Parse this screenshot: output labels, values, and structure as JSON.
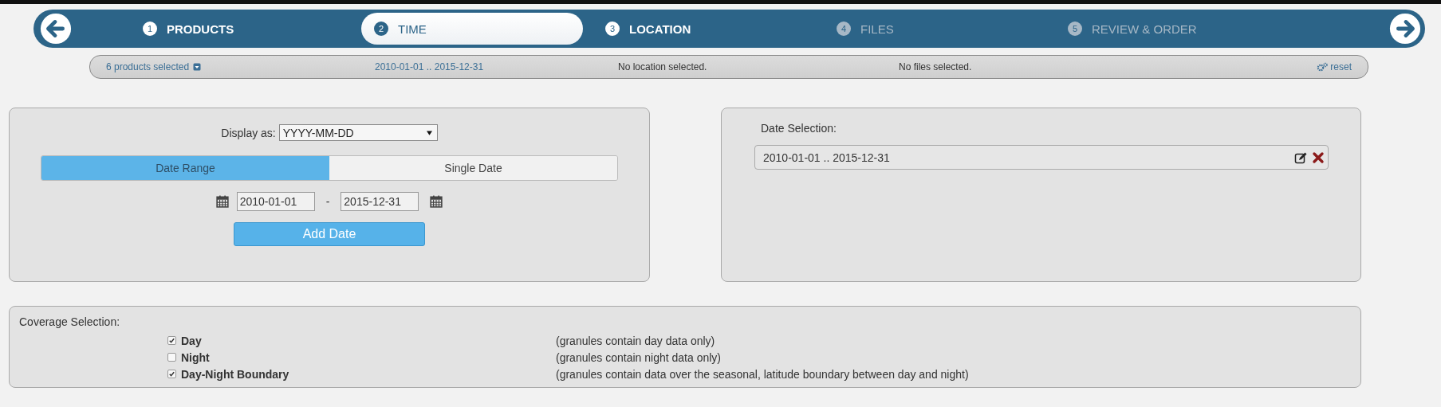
{
  "wizard": {
    "steps": [
      {
        "number": "1",
        "label": "PRODUCTS",
        "selected": false,
        "disabled": false
      },
      {
        "number": "2",
        "label": "TIME",
        "selected": true,
        "disabled": false
      },
      {
        "number": "3",
        "label": "LOCATION",
        "selected": false,
        "disabled": false
      },
      {
        "number": "4",
        "label": "FILES",
        "selected": false,
        "disabled": true
      },
      {
        "number": "5",
        "label": "REVIEW & ORDER",
        "selected": false,
        "disabled": true
      }
    ]
  },
  "summary": {
    "products": "6 products selected",
    "time": "2010-01-01 .. 2015-12-31",
    "location": "No location selected.",
    "files": "No files selected.",
    "reset": "reset"
  },
  "time_panel": {
    "display_label": "Display as:",
    "display_value": "YYYY-MM-DD",
    "modes": [
      {
        "label": "Date Range",
        "selected": true
      },
      {
        "label": "Single Date",
        "selected": false
      }
    ],
    "start_date": "2010-01-01",
    "separator": "-",
    "end_date": "2015-12-31",
    "add_button": "Add Date"
  },
  "date_selection": {
    "label": "Date Selection:",
    "entries": [
      "2010-01-01 .. 2015-12-31"
    ]
  },
  "coverage": {
    "label": "Coverage Selection:",
    "options": [
      {
        "label": "Day",
        "description": "(granules contain day data only)",
        "checked": true
      },
      {
        "label": "Night",
        "description": "(granules contain night data only)",
        "checked": false
      },
      {
        "label": "Day-Night Boundary",
        "description": "(granules contain data over the seasonal, latitude boundary between day and night)",
        "checked": true
      }
    ]
  }
}
